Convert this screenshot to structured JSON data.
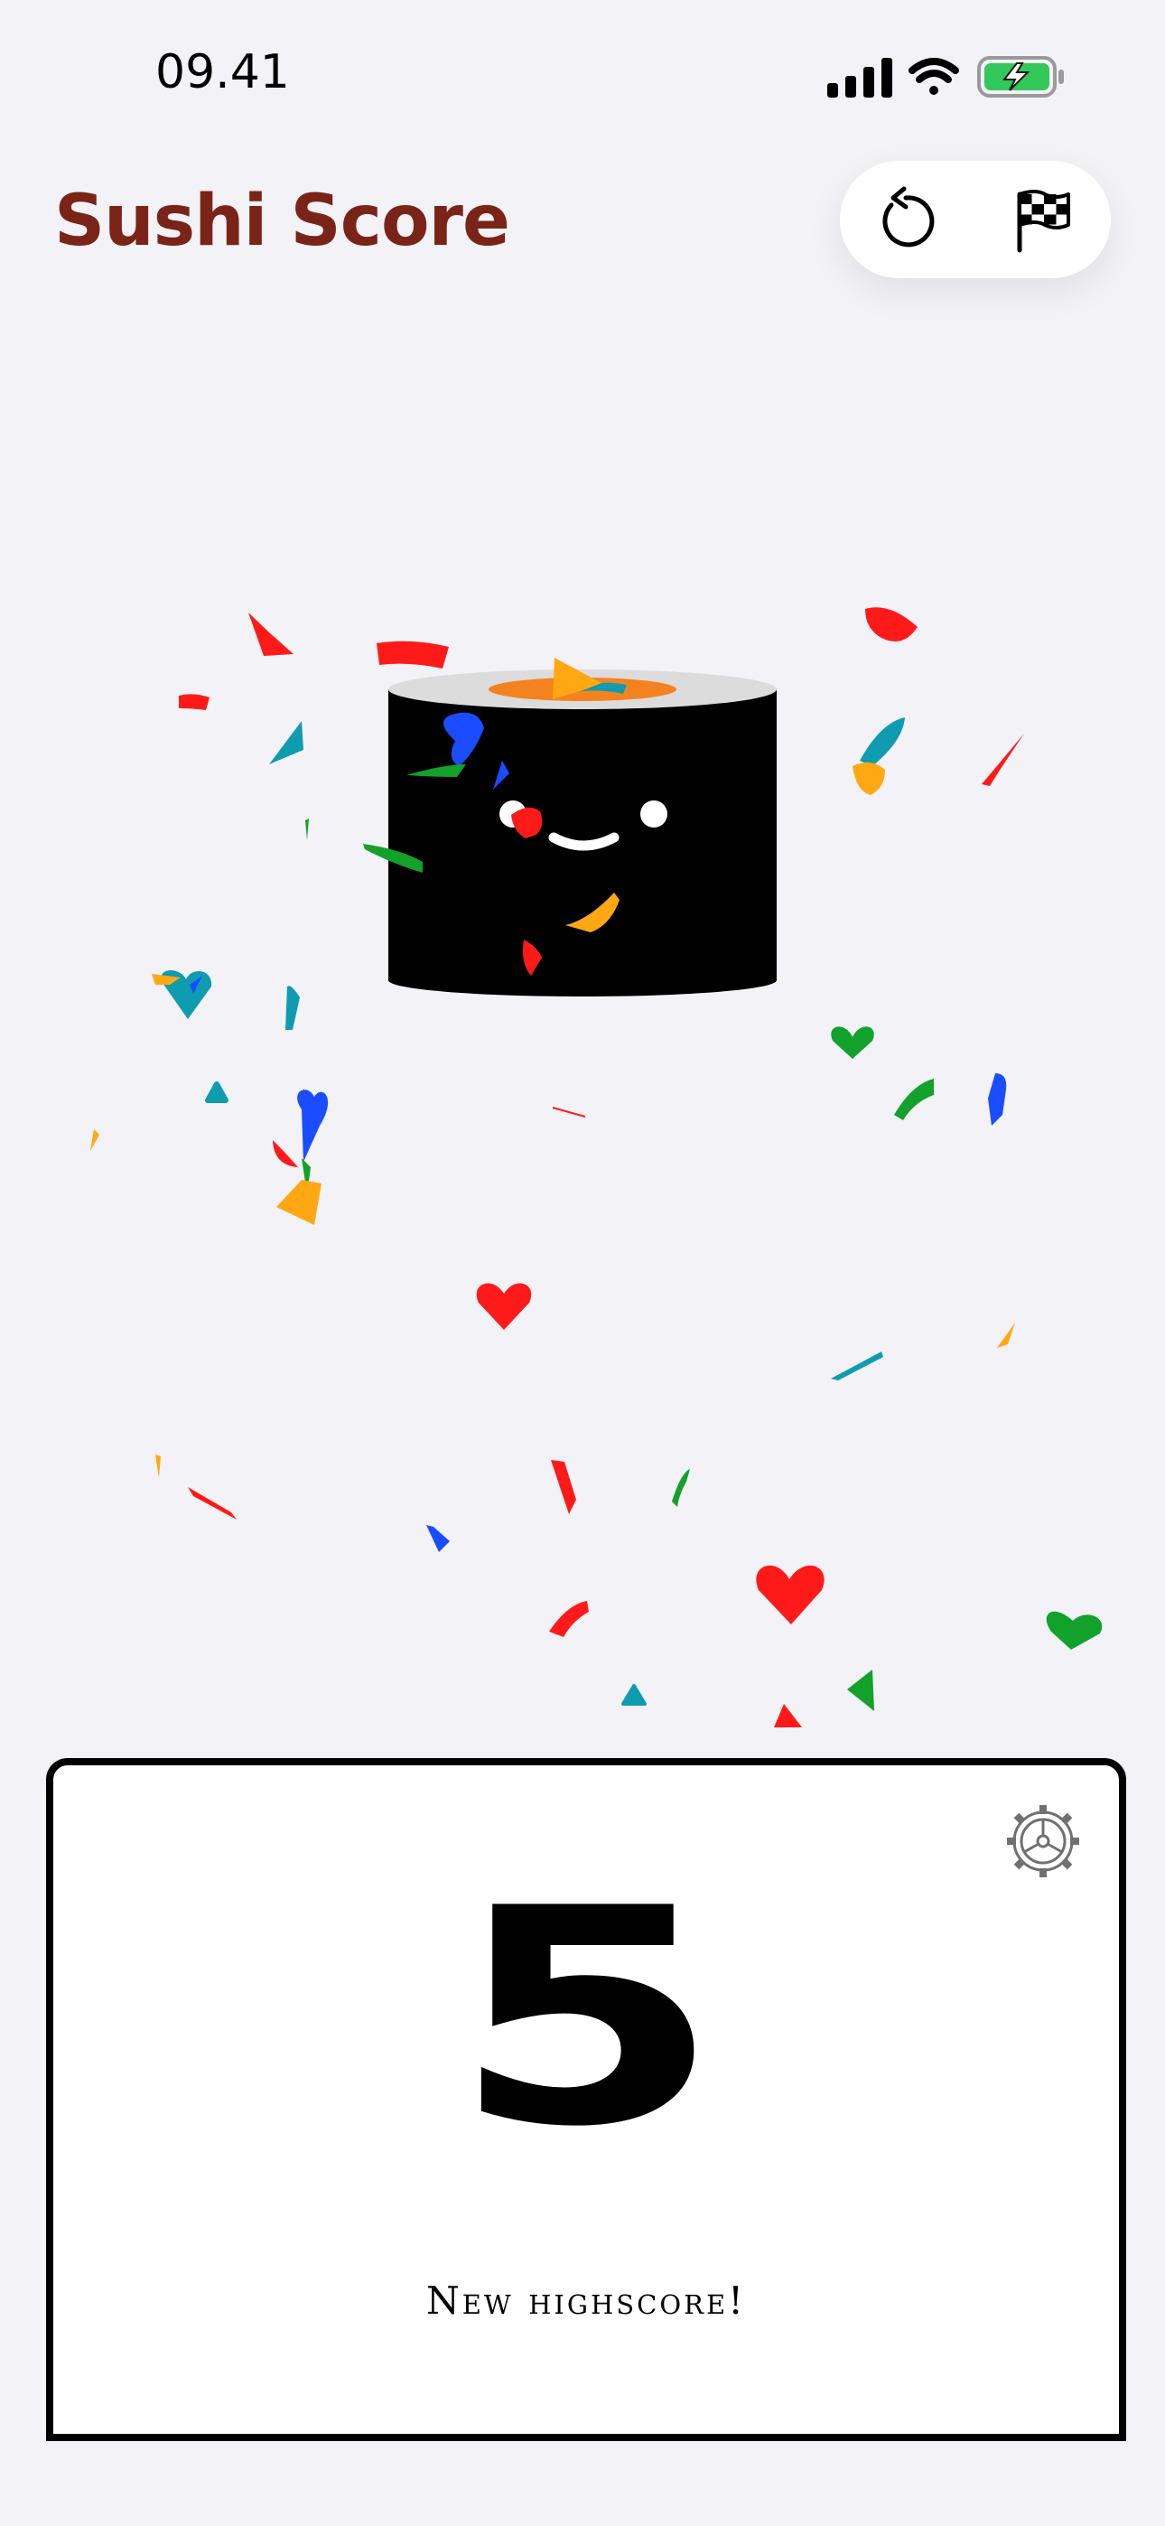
{
  "status_bar": {
    "time": "09.41",
    "icons": [
      "cellular-signal-icon",
      "wifi-icon",
      "battery-charging-icon"
    ],
    "battery_color": "#34c759"
  },
  "header": {
    "title": "Sushi Score",
    "title_color": "#7a2418",
    "actions": [
      {
        "name": "reset-button",
        "icon": "counterclockwise-arrow-icon"
      },
      {
        "name": "finish-button",
        "icon": "checkered-flag-icon"
      }
    ]
  },
  "sushi": {
    "character": "happy-sushi-roll",
    "colors": {
      "nori": "#000000",
      "rice": "#e0e0e0",
      "salmon": "#f4821f"
    }
  },
  "confetti": {
    "colors": [
      "#ff1a1a",
      "#0f9bb0",
      "#1a4dff",
      "#12a12a",
      "#ffa814"
    ]
  },
  "score_card": {
    "score": "5",
    "message": "New highscore!",
    "settings_icon": "gear-icon"
  }
}
